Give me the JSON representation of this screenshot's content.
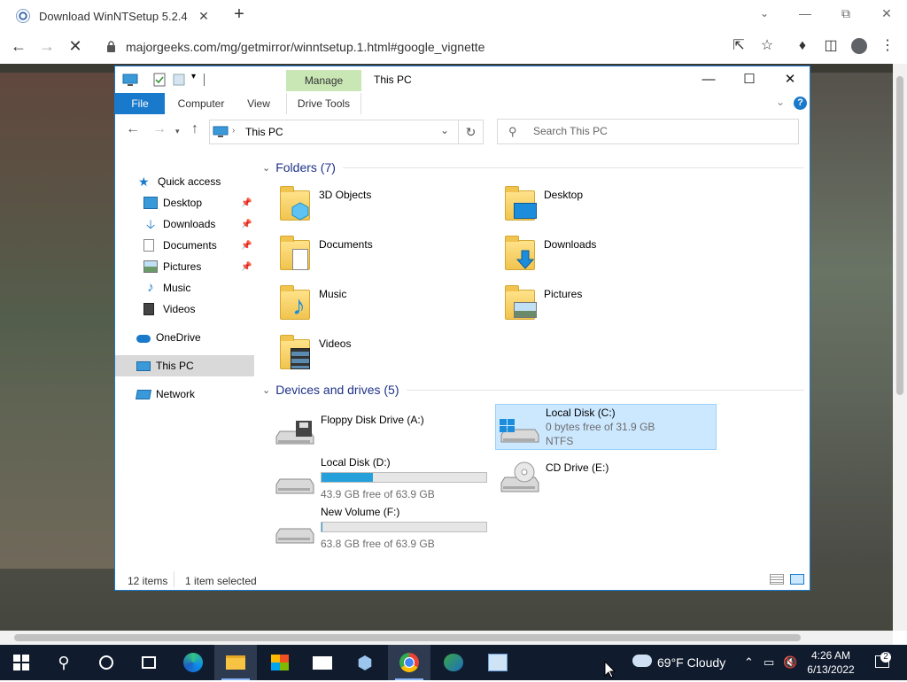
{
  "browser": {
    "tab_title": "Download WinNTSetup 5.2.4",
    "tab_close": "✕",
    "new_tab": "+",
    "url": "majorgeeks.com/mg/getmirror/winntsetup.1.html#google_vignette"
  },
  "explorer": {
    "title": "This PC",
    "ribbon": {
      "manage": "Manage",
      "file": "File",
      "computer": "Computer",
      "view": "View",
      "drive_tools": "Drive Tools"
    },
    "address": "This PC",
    "search_placeholder": "Search This PC",
    "sidebar": {
      "quick_access": "Quick access",
      "desktop": "Desktop",
      "downloads": "Downloads",
      "documents": "Documents",
      "pictures": "Pictures",
      "music": "Music",
      "videos": "Videos",
      "onedrive": "OneDrive",
      "this_pc": "This PC",
      "network": "Network"
    },
    "folders_header": "Folders (7)",
    "folders": [
      "3D Objects",
      "Desktop",
      "Documents",
      "Downloads",
      "Music",
      "Pictures",
      "Videos"
    ],
    "devices_header": "Devices and drives (5)",
    "drives": {
      "floppy": {
        "name": "Floppy Disk Drive (A:)"
      },
      "c": {
        "name": "Local Disk (C:)",
        "free": "0 bytes free of 31.9 GB",
        "fs": "NTFS"
      },
      "d": {
        "name": "Local Disk (D:)",
        "free": "43.9 GB free of 63.9 GB",
        "used_fraction": 0.31
      },
      "e": {
        "name": "CD Drive (E:)"
      },
      "f": {
        "name": "New Volume (F:)",
        "free": "63.8 GB free of 63.9 GB",
        "used_fraction": 0.002
      }
    },
    "status": {
      "items": "12 items",
      "selected": "1 item selected"
    }
  },
  "taskbar": {
    "weather": "69°F  Cloudy",
    "time": "4:26 AM",
    "date": "6/13/2022",
    "notifications": "2"
  },
  "colors": {
    "accent": "#1979ca",
    "selection": "#cce8ff",
    "manage_tab": "#c9e7b5",
    "taskbar": "#101b2e"
  }
}
